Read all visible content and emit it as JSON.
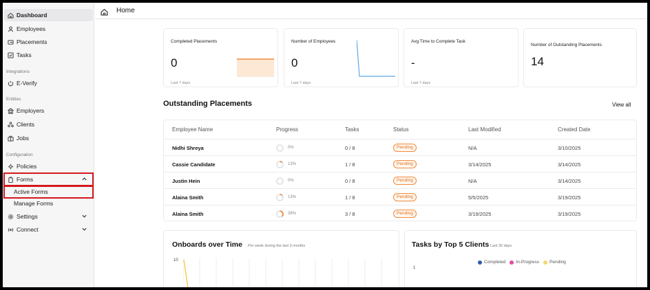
{
  "sidebar": {
    "items": {
      "dashboard": {
        "label": "Dashboard",
        "icon": "home-icon"
      },
      "employees": {
        "label": "Employees",
        "icon": "user-icon"
      },
      "placements": {
        "label": "Placements",
        "icon": "placements-icon"
      },
      "tasks": {
        "label": "Tasks",
        "icon": "checkbox-icon"
      },
      "everify": {
        "label": "E-Verify",
        "icon": "verify-icon"
      },
      "employers": {
        "label": "Employers",
        "icon": "building-icon"
      },
      "clients": {
        "label": "Clients",
        "icon": "clients-icon"
      },
      "jobs": {
        "label": "Jobs",
        "icon": "briefcase-icon"
      },
      "policies": {
        "label": "Policies",
        "icon": "policy-icon"
      },
      "forms": {
        "label": "Forms",
        "icon": "clipboard-icon"
      },
      "settings": {
        "label": "Settings",
        "icon": "gear-icon"
      },
      "connect": {
        "label": "Connect",
        "icon": "connect-icon"
      }
    },
    "sections": {
      "integrations": "Integrations",
      "entities": "Entities",
      "configuration": "Configuration"
    },
    "forms_sub": {
      "active": "Active Forms",
      "manage": "Manage Forms"
    }
  },
  "header": {
    "title": "Home"
  },
  "stats": {
    "completed": {
      "label": "Completed Placements",
      "value": "0",
      "sub": "Last 7 days"
    },
    "employees": {
      "label": "Number of Employees",
      "value": "0",
      "sub": "Last 7 days"
    },
    "avg_time": {
      "label": "Avg Time to Complete Task",
      "value": "-",
      "sub": "Last 7 days"
    },
    "outstanding": {
      "label": "Number of Outstanding Placements",
      "value": "14"
    }
  },
  "outstanding": {
    "title": "Outstanding Placements",
    "view_all": "View all",
    "columns": [
      "Employee Name",
      "Progress",
      "Tasks",
      "Status",
      "Last Modified",
      "Created Date"
    ],
    "rows": [
      {
        "name": "Nidhi Shreya",
        "progress": "0%",
        "progress_value": 0,
        "tasks": "0 / 8",
        "status": "Pending",
        "modified": "N/A",
        "created": "3/10/2025"
      },
      {
        "name": "Cassie Candidate",
        "progress": "13%",
        "progress_value": 13,
        "tasks": "1 / 8",
        "status": "Pending",
        "modified": "3/14/2025",
        "created": "3/14/2025"
      },
      {
        "name": "Justin Hein",
        "progress": "0%",
        "progress_value": 0,
        "tasks": "0 / 8",
        "status": "Pending",
        "modified": "N/A",
        "created": "3/14/2025"
      },
      {
        "name": "Alaina Smith",
        "progress": "13%",
        "progress_value": 13,
        "tasks": "1 / 8",
        "status": "Pending",
        "modified": "5/5/2025",
        "created": "3/19/2025"
      },
      {
        "name": "Alaina Smith",
        "progress": "38%",
        "progress_value": 38,
        "tasks": "3 / 8",
        "status": "Pending",
        "modified": "3/19/2025",
        "created": "3/19/2025"
      }
    ]
  },
  "onboards": {
    "title": "Onboards over Time",
    "sub": "Per week during the last 3 months",
    "y_tick": "10"
  },
  "top_clients": {
    "title": "Tasks by Top 5 Clients",
    "sub": "Last 30 days",
    "y_tick": "1",
    "legend": [
      {
        "label": "Completed",
        "color": "#2f5bb7"
      },
      {
        "label": "In-Progress",
        "color": "#e64aa0"
      },
      {
        "label": "Pending",
        "color": "#f5d76e"
      }
    ]
  },
  "colors": {
    "accent_orange": "#f08a3c",
    "highlight_red": "#d4171c",
    "spark_blue": "#5aa7e8"
  }
}
